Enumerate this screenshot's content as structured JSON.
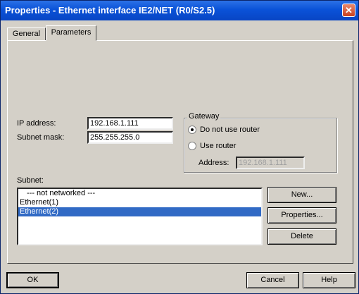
{
  "window": {
    "title": "Properties - Ethernet interface  IE2/NET (R0/S2.5)"
  },
  "tabs": [
    {
      "label": "General"
    },
    {
      "label": "Parameters"
    }
  ],
  "form": {
    "ip_label": "IP address:",
    "ip_value": "192.168.1.111",
    "subnet_label": "Subnet mask:",
    "subnet_value": "255.255.255.0"
  },
  "gateway": {
    "title": "Gateway",
    "option_no_router": "Do not use router",
    "option_use_router": "Use router",
    "selected": "Do not use router",
    "address_label": "Address:",
    "address_value": "192.168.1.111"
  },
  "subnet": {
    "label": "Subnet:",
    "items": [
      "--- not networked ---",
      "Ethernet(1)",
      "Ethernet(2)"
    ],
    "selected": "Ethernet(2)"
  },
  "side_buttons": {
    "new": "New...",
    "properties": "Properties...",
    "delete": "Delete"
  },
  "footer": {
    "ok": "OK",
    "cancel": "Cancel",
    "help": "Help"
  },
  "colors": {
    "title_bar": "#0a52d8",
    "selection": "#316ac5",
    "face": "#d4d0c8"
  }
}
